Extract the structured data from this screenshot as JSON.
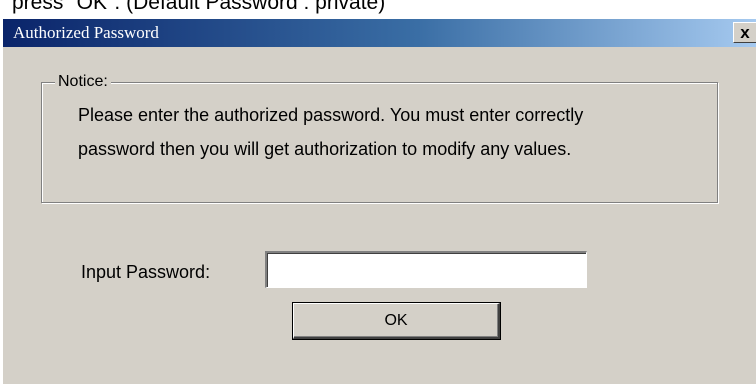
{
  "caption": "press \"OK\". (Default Password : private)",
  "dialog": {
    "title": "Authorized Password",
    "close_label": "x",
    "notice": {
      "legend": "Notice:",
      "line1": "Please enter the authorized password. You must enter correctly",
      "line2": "password then you will get authorization to modify any values."
    },
    "password": {
      "label": "Input Password:",
      "value": ""
    },
    "ok_label": "OK"
  },
  "colors": {
    "titlebar_start": "#0a246a",
    "titlebar_end": "#a6caf0",
    "dialog_face": "#d4d0c8"
  },
  "icons": {
    "close": "close-icon"
  }
}
